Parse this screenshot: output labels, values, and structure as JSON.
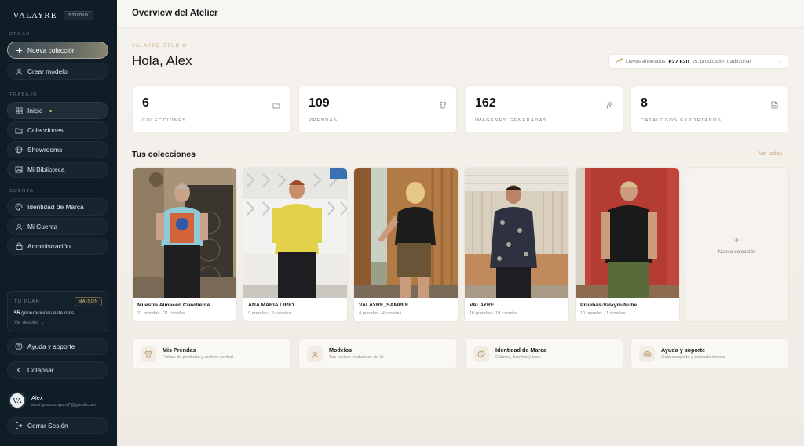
{
  "brand": {
    "name": "VALAYRE",
    "badge": "STUDIO"
  },
  "sidebar": {
    "section_crear": "CREAR",
    "nueva_coleccion": "Nueva colección",
    "crear_modelo": "Crear modelo",
    "section_trabajo": "TRABAJO",
    "items_trabajo": [
      {
        "label": "Inicio"
      },
      {
        "label": "Colecciones"
      },
      {
        "label": "Showrooms"
      },
      {
        "label": "Mi Biblioteca"
      }
    ],
    "section_cuenta": "CUENTA",
    "items_cuenta": [
      {
        "label": "Identidad de Marca"
      },
      {
        "label": "Mi Cuenta"
      },
      {
        "label": "Administración"
      }
    ],
    "plan": {
      "label": "TU PLAN",
      "badge": "MAISON",
      "count": "55",
      "count_suffix": "generaciones este mes",
      "link": "Ver detalles →"
    },
    "help": "Ayuda y soporte",
    "collapse": "Colapsar",
    "user": {
      "initials": "VA",
      "name": "Alex",
      "email": "andrigueszunguru7@gmail.com"
    },
    "logout": "Cerrar Sesión"
  },
  "header": {
    "title": "Overview del Atelier"
  },
  "hero": {
    "eyebrow": "VALAYRE STUDIO",
    "greeting": "Hola, Alex",
    "savings_prefix": "Llevas ahorrados",
    "savings_value": "€27.620",
    "savings_suffix": "vs. producción tradicional"
  },
  "stats": [
    {
      "value": "6",
      "label": "COLECCIONES",
      "icon": "folder-icon"
    },
    {
      "value": "109",
      "label": "PRENDAS",
      "icon": "shirt-icon"
    },
    {
      "value": "162",
      "label": "IMÁGENES GENERADAS",
      "icon": "sparkles-icon"
    },
    {
      "value": "8",
      "label": "CATÁLOGOS EXPORTADOS",
      "icon": "document-icon"
    }
  ],
  "collections": {
    "title": "Tus colecciones",
    "see_all": "Ver todas →",
    "items": [
      {
        "name": "Muestra Almacén Crevillente",
        "meta": "21 prendas · 21 curadas"
      },
      {
        "name": "ANA MARIA LIRIO",
        "meta": "9 prendas · 9 curadas"
      },
      {
        "name": "VALAYRE_SAMPLE",
        "meta": "4 prendas · 4 curadas"
      },
      {
        "name": "VALAYRE",
        "meta": "10 prendas · 10 curadas"
      },
      {
        "name": "Pruebas-Valayre-Nube",
        "meta": "10 prendas · 1 curadas"
      }
    ],
    "new_label": "Nueva colección"
  },
  "quick_links": [
    {
      "title": "Mis Prendas",
      "subtitle": "Fichas de producto y archivo central"
    },
    {
      "title": "Modelos",
      "subtitle": "Tus rostros exclusivos de IA"
    },
    {
      "title": "Identidad de Marca",
      "subtitle": "Colores, fuentes y tono"
    },
    {
      "title": "Ayuda y soporte",
      "subtitle": "Guía completa y contacto directo"
    }
  ],
  "colors": {
    "sidebar": "#0f1d27",
    "accent": "#c9a978",
    "background": "#f3f0eb"
  }
}
